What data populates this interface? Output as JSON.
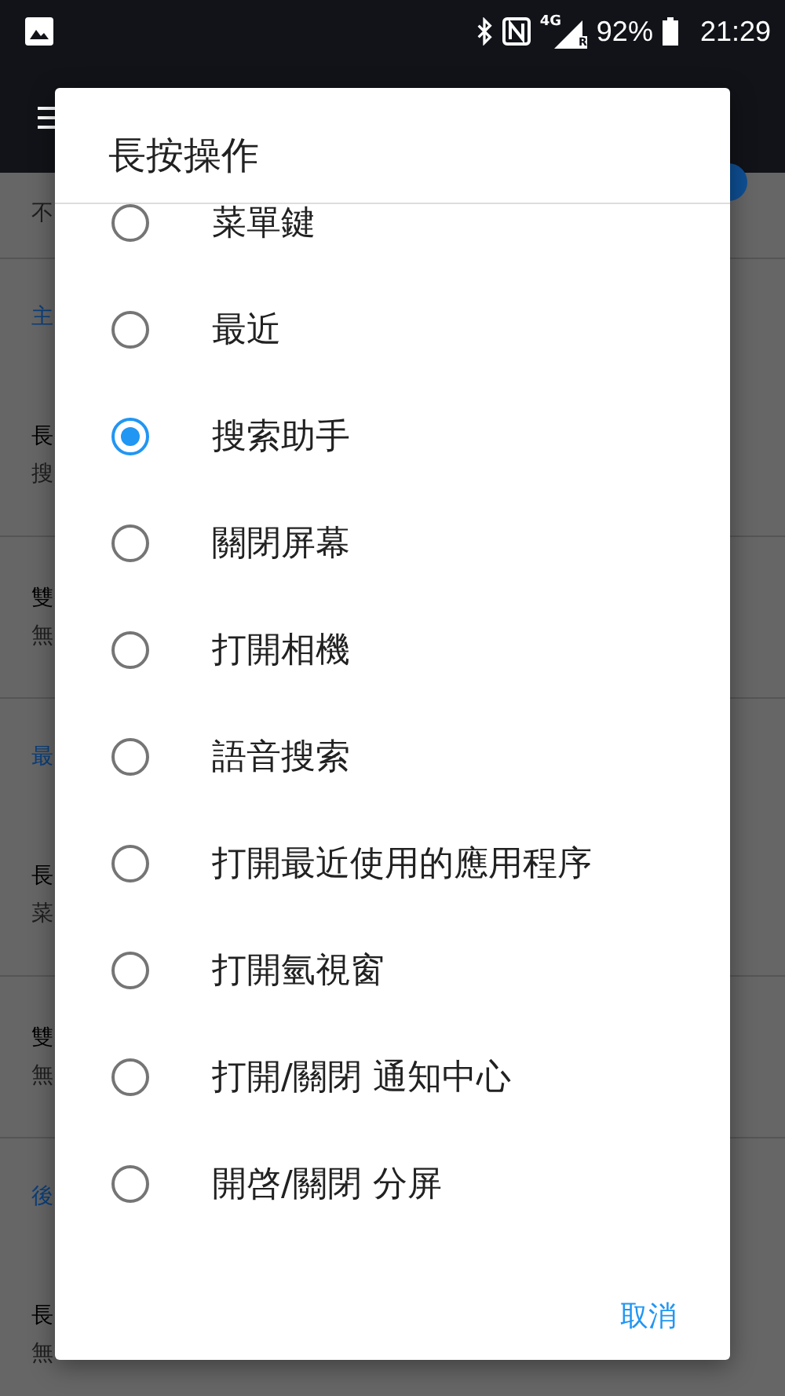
{
  "status_bar": {
    "network": "4G",
    "roaming": "R",
    "battery": "92%",
    "time": "21:29"
  },
  "background": {
    "toggle": {
      "on": true
    },
    "rows": [
      {
        "kind": "item",
        "subtitle": "不"
      },
      {
        "kind": "section",
        "title": "主"
      },
      {
        "kind": "item",
        "title": "長",
        "subtitle": "搜"
      },
      {
        "kind": "item",
        "title": "雙",
        "subtitle": "無"
      },
      {
        "kind": "section",
        "title": "最"
      },
      {
        "kind": "item",
        "title": "長",
        "subtitle": "菜"
      },
      {
        "kind": "item",
        "title": "雙",
        "subtitle": "無"
      },
      {
        "kind": "section",
        "title": "後"
      },
      {
        "kind": "item",
        "title": "長",
        "subtitle": "無"
      }
    ]
  },
  "dialog": {
    "title": "長按操作",
    "options": [
      {
        "label": "菜單鍵",
        "selected": false
      },
      {
        "label": "最近",
        "selected": false
      },
      {
        "label": "搜索助手",
        "selected": true
      },
      {
        "label": "關閉屏幕",
        "selected": false
      },
      {
        "label": "打開相機",
        "selected": false
      },
      {
        "label": "語音搜索",
        "selected": false
      },
      {
        "label": "打開最近使用的應用程序",
        "selected": false
      },
      {
        "label": "打開氫視窗",
        "selected": false
      },
      {
        "label": "打開/關閉 通知中心",
        "selected": false
      },
      {
        "label": "開啓/關閉 分屏",
        "selected": false
      }
    ],
    "buttons": [
      "取消"
    ]
  }
}
